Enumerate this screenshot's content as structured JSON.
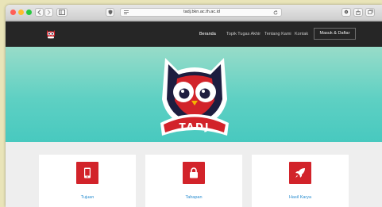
{
  "browser": {
    "url": "tadj.bkn.ac.th.ac.id"
  },
  "navbar": {
    "items": [
      {
        "label": "Beranda"
      },
      {
        "label": "Topik Tugas Akhir"
      },
      {
        "label": "Tentang Kami"
      },
      {
        "label": "Kontak"
      }
    ],
    "login_label": "Masuk & Daftar"
  },
  "hero": {
    "logo_text": "TADJ"
  },
  "cards": [
    {
      "label": "Tujuan",
      "icon": "tablet-icon"
    },
    {
      "label": "Tahapan",
      "icon": "lock-icon"
    },
    {
      "label": "Hasil Karya",
      "icon": "rocket-icon"
    }
  ],
  "colors": {
    "accent_red": "#d2232a",
    "hero_teal": "#5ed0c3",
    "navbar_dark": "#262626",
    "link_blue": "#2a8ed0"
  }
}
